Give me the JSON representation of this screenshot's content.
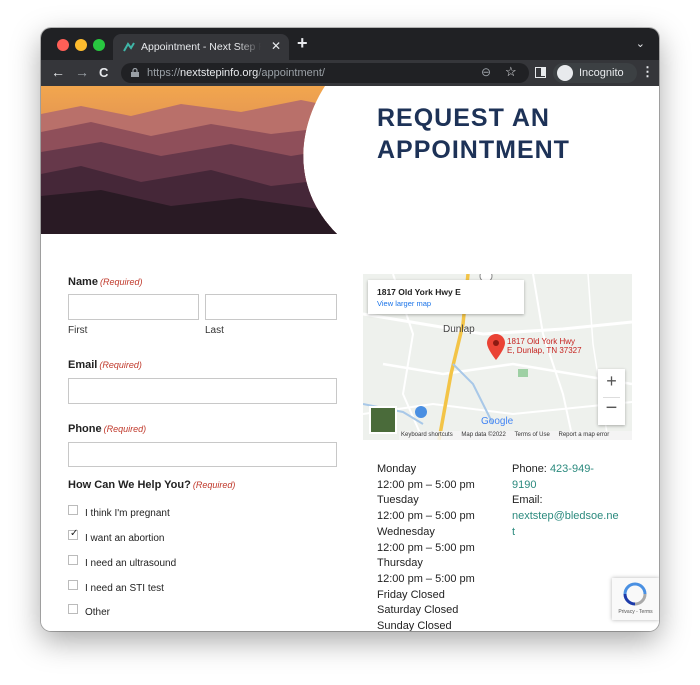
{
  "browser": {
    "tab_title": "Appointment - Next Step Resource",
    "tab_close": "✕",
    "new_tab": "+",
    "tab_menu": "⌄",
    "url_scheme": "https://",
    "url_host": "nextstepinfo.org",
    "url_path": "/appointment/",
    "incognito_label": "Incognito",
    "icons": {
      "back": "arrow-left-icon",
      "forward": "arrow-right-icon",
      "reload": "reload-icon",
      "lock": "lock-icon",
      "zoom": "zoom-icon",
      "bookmark": "star-icon",
      "side_panel": "side-panel-icon",
      "incognito": "incognito-icon",
      "menu": "kebab-menu-icon"
    }
  },
  "page": {
    "title_line1": "REQUEST AN",
    "title_line2": "APPOINTMENT",
    "title_color": "#1d3257"
  },
  "form": {
    "required_text": "(Required)",
    "name": {
      "label": "Name",
      "first_label": "First",
      "last_label": "Last",
      "first_value": "",
      "last_value": ""
    },
    "email": {
      "label": "Email",
      "value": ""
    },
    "phone": {
      "label": "Phone",
      "value": ""
    },
    "help": {
      "label": "How Can We Help You?",
      "options": [
        {
          "label": "I think I'm pregnant",
          "checked": false
        },
        {
          "label": "I want an abortion",
          "checked": true
        },
        {
          "label": "I need an ultrasound",
          "checked": false
        },
        {
          "label": "I need an STI test",
          "checked": false
        },
        {
          "label": "Other",
          "checked": false
        }
      ]
    },
    "check_glyph": "✓"
  },
  "map": {
    "card_title": "1817 Old York Hwy E",
    "card_link": "View larger map",
    "town": "Dunlap",
    "pin_label_line1": "1817 Old York Hwy",
    "pin_label_line2": "E, Dunlap, TN 37327",
    "zoom_in": "+",
    "zoom_out": "−",
    "google": "Google",
    "footer": [
      "Keyboard shortcuts",
      "Map data ©2022",
      "Terms of Use",
      "Report a map error"
    ]
  },
  "hours": [
    "Monday",
    "12:00 pm – 5:00 pm",
    "Tuesday",
    "12:00 pm – 5:00 pm",
    "Wednesday",
    "12:00 pm – 5:00 pm",
    "Thursday",
    "12:00 pm – 5:00 pm",
    "Friday Closed",
    "Saturday Closed",
    "Sunday Closed"
  ],
  "contact": {
    "phone_label": "Phone:",
    "phone_part1": "423-949-",
    "phone_part2": "9190",
    "email_label": "Email:",
    "email_part1": "nextstep@bledsoe.ne",
    "email_part2": "t"
  },
  "recaptcha": {
    "text": "Privacy - Terms"
  }
}
